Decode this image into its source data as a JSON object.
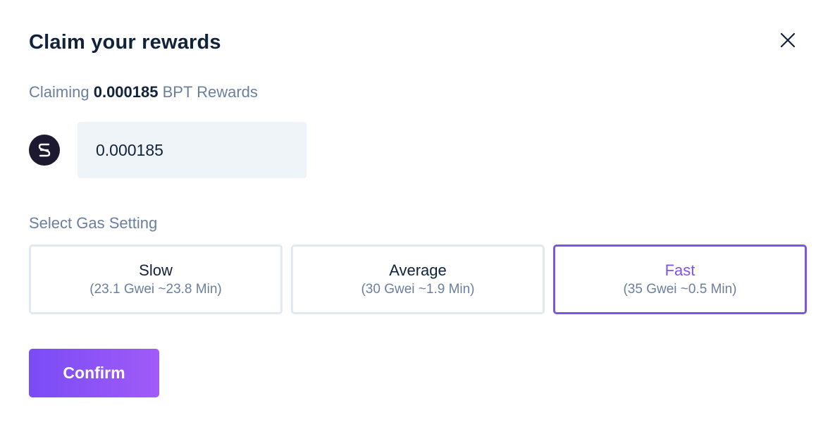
{
  "modal": {
    "title": "Claim your rewards",
    "close_icon": "close-icon"
  },
  "claim": {
    "prefix": "Claiming",
    "amount": "0.000185",
    "suffix": "BPT Rewards"
  },
  "token": {
    "icon": "token-logo-icon",
    "glyph": "S",
    "input_value": "0.000185"
  },
  "gas": {
    "label": "Select Gas Setting",
    "selected": "Fast",
    "options": [
      {
        "name": "Slow",
        "detail": "(23.1 Gwei ~23.8 Min)"
      },
      {
        "name": "Average",
        "detail": "(30 Gwei ~1.9 Min)"
      },
      {
        "name": "Fast",
        "detail": "(35 Gwei ~0.5 Min)"
      }
    ]
  },
  "actions": {
    "confirm_label": "Confirm"
  },
  "colors": {
    "accent": "#7a55e6",
    "text_primary": "#12223a",
    "text_secondary": "#6c7e9e",
    "input_bg": "#eff4f8",
    "border": "#e2e9f0"
  }
}
